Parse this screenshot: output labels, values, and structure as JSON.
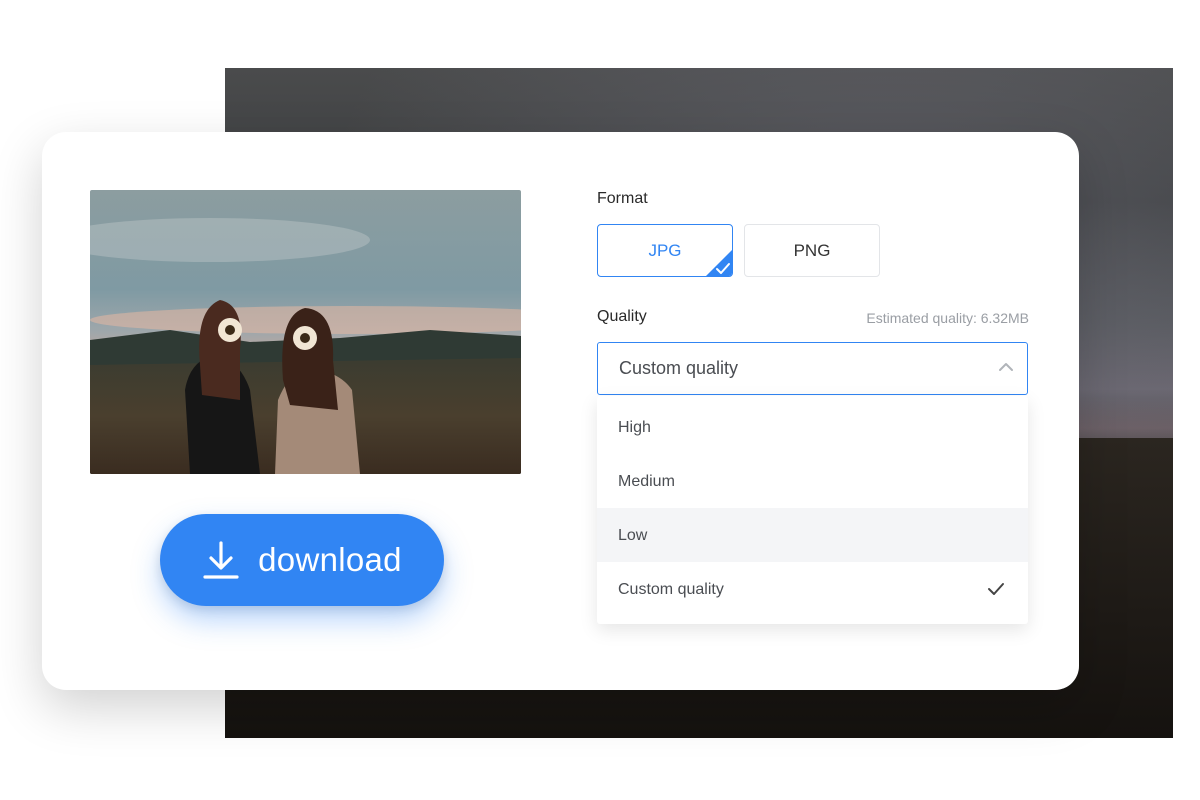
{
  "export_panel": {
    "download_label": "download",
    "format": {
      "label": "Format",
      "options": [
        "JPG",
        "PNG"
      ],
      "selected": "JPG"
    },
    "quality": {
      "label": "Quality",
      "estimate": "Estimated quality: 6.32MB",
      "selected": "Custom quality",
      "options": [
        "High",
        "Medium",
        "Low",
        "Custom quality"
      ],
      "hovered": "Low"
    }
  },
  "colors": {
    "accent": "#3185f3",
    "hover_row": "#f4f5f7"
  },
  "icons": {
    "download": "download-arrow-icon",
    "selected_format": "check-corner-icon",
    "dropdown": "chevron-up-icon",
    "selected_option": "checkmark-icon"
  }
}
